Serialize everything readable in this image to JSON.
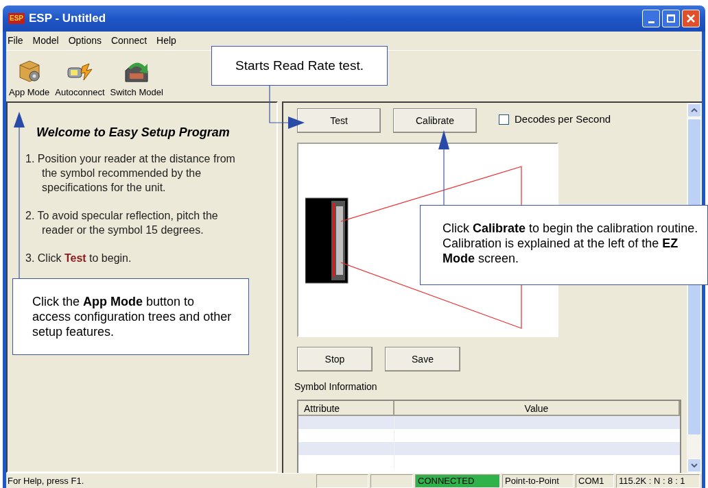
{
  "window": {
    "title": "ESP - Untitled",
    "logo": "ESP"
  },
  "menu": [
    "File",
    "Model",
    "Options",
    "Connect",
    "Help"
  ],
  "toolbar": [
    {
      "kind": "appmode",
      "label": "App Mode"
    },
    {
      "kind": "autoconnect",
      "label": "Autoconnect"
    },
    {
      "kind": "switch",
      "label": "Switch Model"
    }
  ],
  "left_panel": {
    "heading": "Welcome to Easy Setup Program",
    "steps": [
      "1. Position your reader at the distance from",
      "the symbol recommended by the",
      "specifications for the unit.",
      "2. To avoid specular reflection, pitch the",
      "reader or the symbol 15 degrees.",
      "3. Click **Test** to begin."
    ]
  },
  "right_panel": {
    "top_buttons": [
      "Test",
      "Calibrate"
    ],
    "checkbox": {
      "label": "Decodes per Second",
      "checked": false
    },
    "bottom_buttons": [
      "Stop",
      "Save"
    ],
    "section_label": "Symbol Information",
    "table": {
      "columns": [
        "Attribute",
        "Value"
      ]
    }
  },
  "callouts": [
    {
      "text": "Starts Read Rate test."
    },
    {
      "text": "Click the **App Mode** button to access configuration trees and other setup features."
    },
    {
      "text": "Click **Calibrate** to begin the calibration routine. Calibration is explained at the left of the **EZ Mode** screen."
    }
  ],
  "status_bar": {
    "help": "For Help, press F1.",
    "panes": [
      {
        "text": "CONNECTED",
        "color": "#2fb24a"
      },
      {
        "text": "Point-to-Point"
      },
      {
        "text": "COM1"
      },
      {
        "text": "115.2K : N : 8 : 1"
      }
    ]
  }
}
